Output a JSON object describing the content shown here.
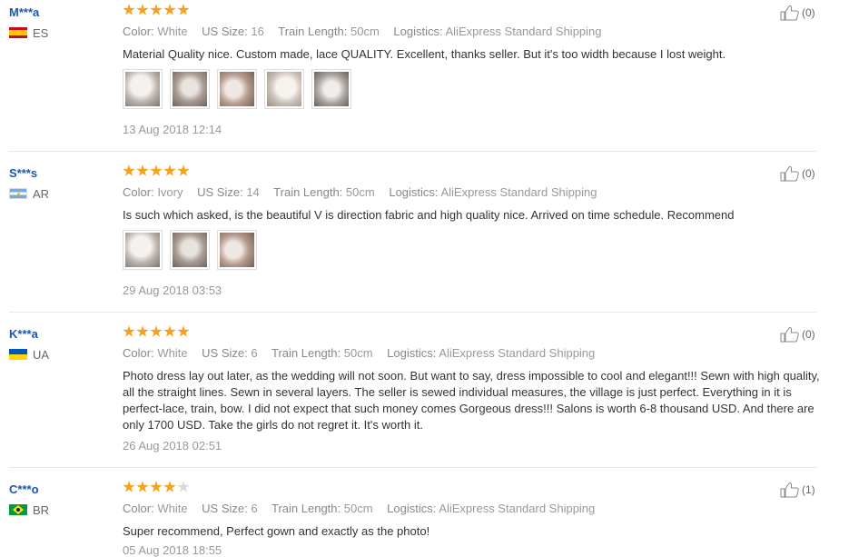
{
  "reviews": [
    {
      "user": "M***a",
      "country": "ES",
      "rating": 5,
      "attrs": [
        {
          "key": "Color:",
          "value": "White"
        },
        {
          "key": "US Size:",
          "value": "16"
        },
        {
          "key": "Train Length:",
          "value": "50cm"
        },
        {
          "key": "Logistics:",
          "value": "AliExpress Standard Shipping"
        }
      ],
      "content": "Material Quality nice. Custom made, lace QUALITY. Excellent, thanks seller. But it's too width because I lost weight.",
      "photos": 5,
      "date": "13 Aug 2018 12:14",
      "likes": "(0)"
    },
    {
      "user": "S***s",
      "country": "AR",
      "rating": 5,
      "attrs": [
        {
          "key": "Color:",
          "value": "Ivory"
        },
        {
          "key": "US Size:",
          "value": "14"
        },
        {
          "key": "Train Length:",
          "value": "50cm"
        },
        {
          "key": "Logistics:",
          "value": "AliExpress Standard Shipping"
        }
      ],
      "content": "Is such which asked, is the beautiful V is direction fabric and high quality nice. Arrived on time schedule. Recommend",
      "photos": 3,
      "date": "29 Aug 2018 03:53",
      "likes": "(0)"
    },
    {
      "user": "K***a",
      "country": "UA",
      "rating": 5,
      "attrs": [
        {
          "key": "Color:",
          "value": "White"
        },
        {
          "key": "US Size:",
          "value": "6"
        },
        {
          "key": "Train Length:",
          "value": "50cm"
        },
        {
          "key": "Logistics:",
          "value": "AliExpress Standard Shipping"
        }
      ],
      "content": "Photo dress lay out later, as the wedding will not soon. But want to say, dress impossible to cool and elegant!!! Sewn with high quality, all the straight lines. Sewn in several layers. The seller is sewed individual measures, the village is just perfect. Everything in it is perfect-lace, train, bow. I did not expect that such money comes Gorgeous dress!!! Salons is worth 6-8 thousand USD. And there are only 1700 USD. Take the girls do not regret it. It's worth it.",
      "photos": 0,
      "date": "26 Aug 2018 02:51",
      "likes": "(0)"
    },
    {
      "user": "C***o",
      "country": "BR",
      "rating": 4,
      "attrs": [
        {
          "key": "Color:",
          "value": "White"
        },
        {
          "key": "US Size:",
          "value": "6"
        },
        {
          "key": "Train Length:",
          "value": "50cm"
        },
        {
          "key": "Logistics:",
          "value": "AliExpress Standard Shipping"
        }
      ],
      "content": "Super recommend, Perfect gown and exactly as the photo!",
      "photos": 0,
      "date": "05 Aug 2018 18:55",
      "likes": "(1)"
    }
  ]
}
